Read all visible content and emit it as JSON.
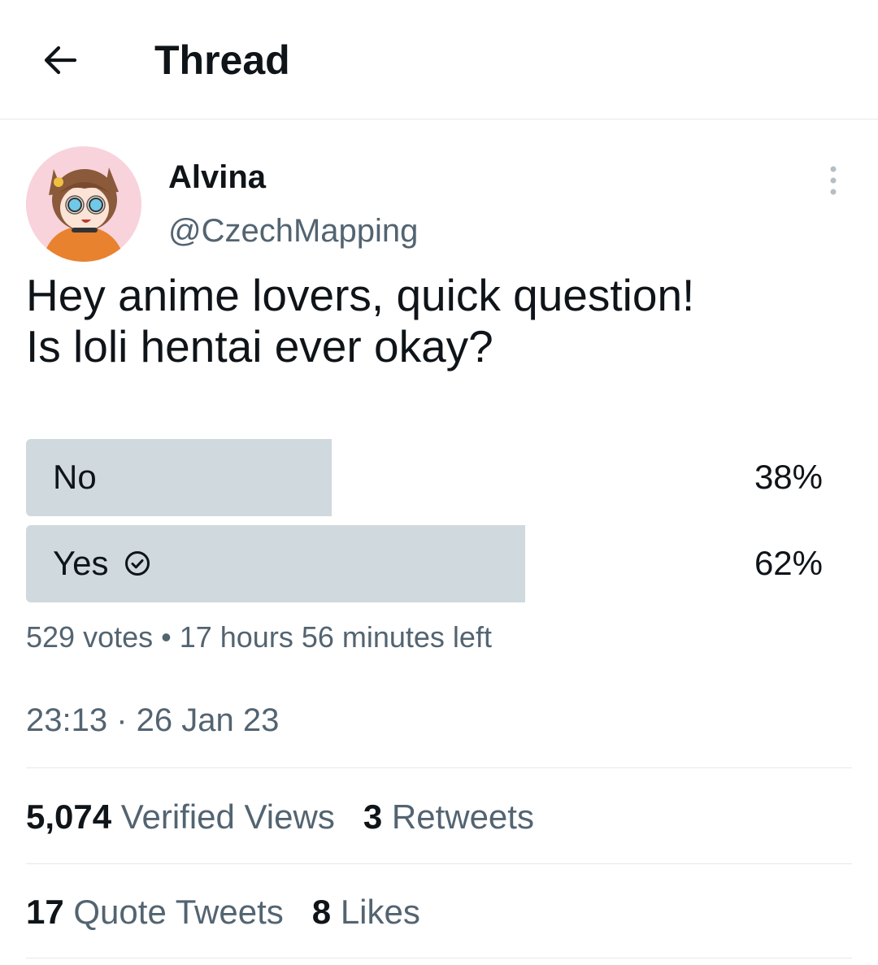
{
  "header": {
    "title": "Thread"
  },
  "author": {
    "name": "Alvina",
    "handle": "@CzechMapping"
  },
  "tweet": {
    "line1": "Hey anime lovers, quick question!",
    "line2": "Is loli hentai ever okay?"
  },
  "poll": {
    "options": [
      {
        "label": "No",
        "percent_text": "38%",
        "share": 0.38
      },
      {
        "label": "Yes",
        "percent_text": "62%",
        "share": 0.62,
        "leading": true
      }
    ],
    "meta": "529 votes • 17 hours 56 minutes left"
  },
  "timestamp": "23:13 · 26 Jan 23",
  "stats": {
    "views_count": "5,074",
    "views_label": "Verified Views",
    "retweets_count": "3",
    "retweets_label": "Retweets",
    "quotes_count": "17",
    "quotes_label": "Quote Tweets",
    "likes_count": "8",
    "likes_label": "Likes"
  },
  "colors": {
    "text": "#0f1419",
    "secondary": "#536471",
    "poll_bar": "#cfd9de",
    "divider": "#e4e8eb"
  },
  "icons": {
    "back": "arrow-left-icon",
    "more": "more-vertical-icon",
    "winner": "check-circle-icon"
  }
}
